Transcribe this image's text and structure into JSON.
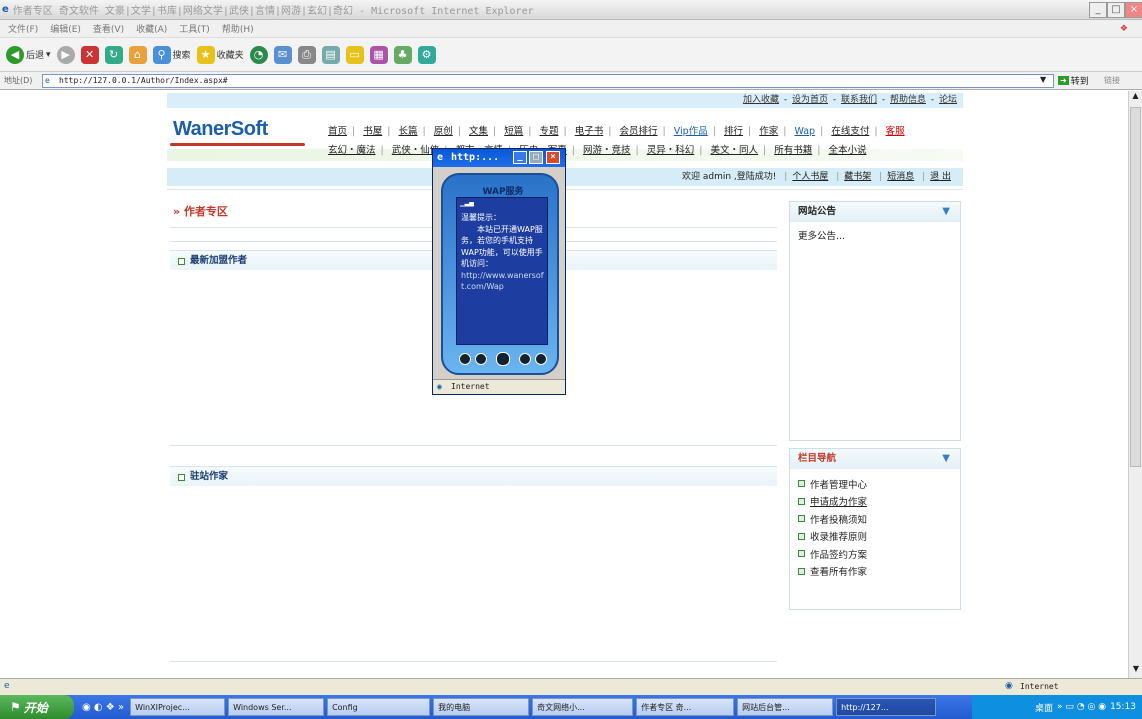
{
  "window": {
    "title": "作者专区 奇文软件 文豪|文学|书库|网络文学|武侠|言情|网游|玄幻|奇幻 - Microsoft Internet Explorer"
  },
  "menu": [
    "文件(F)",
    "编辑(E)",
    "查看(V)",
    "收藏(A)",
    "工具(T)",
    "帮助(H)"
  ],
  "toolbar": {
    "back": "后退",
    "search": "搜索",
    "favorites": "收藏夹"
  },
  "address": {
    "label": "地址(D)",
    "url": "http://127.0.0.1/Author/Index.aspx#",
    "go": "转到",
    "links": "链接"
  },
  "toplinks": [
    "加入收藏",
    "设为首页",
    "联系我们",
    "帮助信息",
    "论坛"
  ],
  "logo": "WanerSoft",
  "nav1": [
    "首页",
    "书屋",
    "长篇",
    "原创",
    "文集",
    "短篇",
    "专题",
    "电子书",
    "会员排行",
    "Vip作品",
    "排行",
    "作家",
    "Wap",
    "在线支付",
    "客服"
  ],
  "nav2": [
    "玄幻・魔法",
    "武侠・仙侠",
    "都市・言情",
    "历史・军事",
    "网游・竞技",
    "灵异・科幻",
    "美文・同人",
    "所有书籍",
    "全本小说"
  ],
  "welcome": {
    "text": "欢迎 admin ,登陆成功!",
    "links": [
      "个人书屋",
      "藏书架",
      "短消息",
      "退 出"
    ]
  },
  "main": {
    "title": "作者专区",
    "bar1": "最新加盟作者",
    "bar2": "驻站作家"
  },
  "sidebar": {
    "notice_title": "网站公告",
    "notice_more": "更多公告...",
    "nav_title": "栏目导航",
    "nav_items": [
      "作者管理中心",
      "申请成为作家",
      "作者投稿须知",
      "收录推荐原则",
      "作品签约方案",
      "查看所有作家"
    ]
  },
  "popup": {
    "title": "http:...",
    "wap_title": "WAP服务",
    "lines": [
      "温馨提示：",
      "本站已开通WAP服务，若您的手机支持WAP功能，可以使用手机访问：",
      "http://www.wanersoft.com/Wap"
    ],
    "status": "Internet"
  },
  "statusbar": {
    "zone": "Internet"
  },
  "taskbar": {
    "start": "开始",
    "tasks": [
      "WinXIProjec...",
      "Windows Ser...",
      "Config",
      "我的电脑",
      "奇文网络小...",
      "作者专区 奇...",
      "网站后台管...",
      "http://127..."
    ],
    "desktop": "桌面",
    "time": "15:13"
  }
}
